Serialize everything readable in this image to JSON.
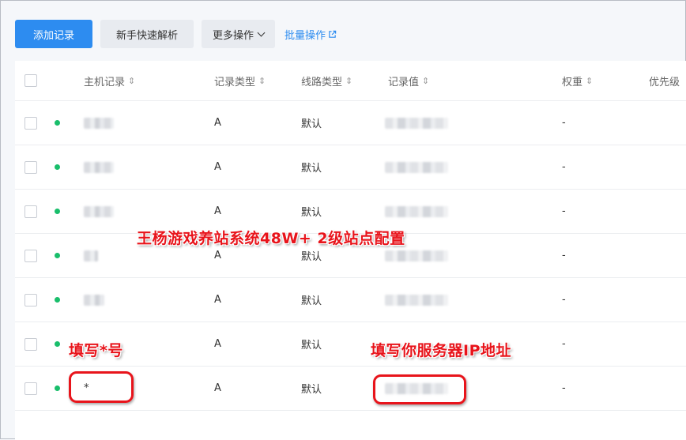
{
  "toolbar": {
    "add_record": "添加记录",
    "quick_parse": "新手快速解析",
    "more_ops": "更多操作",
    "batch_ops": "批量操作"
  },
  "table": {
    "columns": {
      "host": "主机记录",
      "type": "记录类型",
      "line": "线路类型",
      "value": "记录值",
      "weight": "权重",
      "priority": "优先级"
    },
    "rows": [
      {
        "host": "",
        "type": "A",
        "line": "默认",
        "value": "",
        "weight": "-"
      },
      {
        "host": "",
        "type": "A",
        "line": "默认",
        "value": "",
        "weight": "-"
      },
      {
        "host": "",
        "type": "A",
        "line": "默认",
        "value": "",
        "weight": "-"
      },
      {
        "host": "",
        "type": "A",
        "line": "默认",
        "value": "",
        "weight": "-"
      },
      {
        "host": "",
        "type": "A",
        "line": "默认",
        "value": "",
        "weight": "-"
      },
      {
        "host": "",
        "type": "A",
        "line": "默认",
        "value": "",
        "weight": "-"
      },
      {
        "host": "*",
        "type": "A",
        "line": "默认",
        "value": "",
        "weight": "-"
      }
    ]
  },
  "annotations": {
    "title": "王杨游戏养站系统48W+ 2级站点配置",
    "host_hint": "填写*号",
    "ip_hint": "填写你服务器IP地址"
  },
  "colors": {
    "primary": "#2d8cf0",
    "status_dot": "#19be6b",
    "annotation": "#e8141b"
  }
}
